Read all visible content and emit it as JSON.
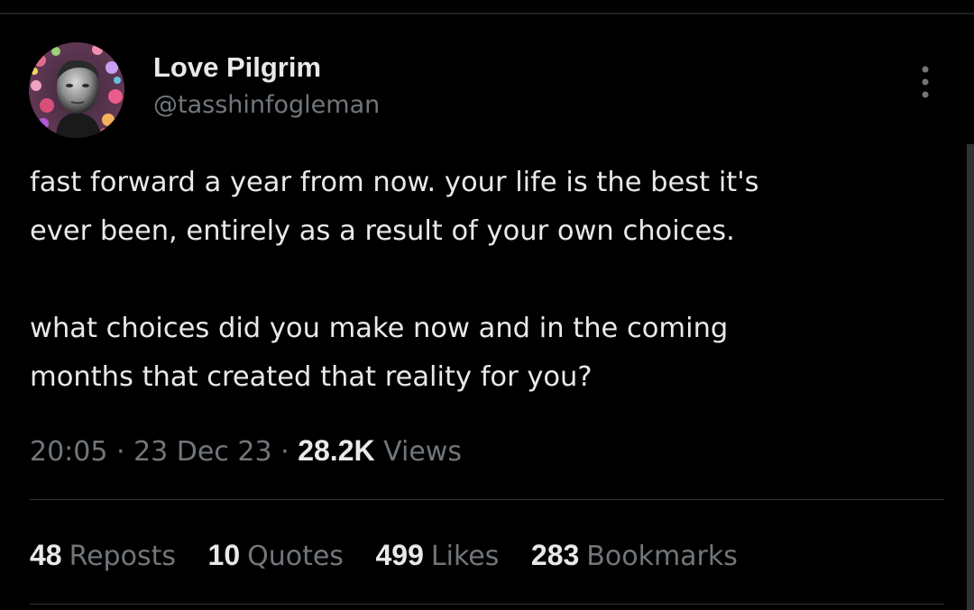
{
  "author": {
    "display_name": "Love Pilgrim",
    "handle": "@tasshinfogleman"
  },
  "tweet": {
    "lines": [
      "fast forward a year from now. your life is the best it's",
      "ever been, entirely as a result of your own choices.",
      "what choices did you make now and in the coming",
      "months that created that reality for you?"
    ],
    "time": "20:05",
    "date": "23 Dec 23",
    "views_count": "28.2K",
    "views_label": "Views"
  },
  "stats": {
    "reposts": {
      "count": "48",
      "label": "Reposts"
    },
    "quotes": {
      "count": "10",
      "label": "Quotes"
    },
    "likes": {
      "count": "499",
      "label": "Likes"
    },
    "bookmarks": {
      "count": "283",
      "label": "Bookmarks"
    }
  },
  "icons": {
    "more": "more-options-icon"
  },
  "colors": {
    "background": "#000000",
    "text_primary": "#e7e9ea",
    "text_secondary": "#71767b",
    "divider": "#2f3336"
  }
}
